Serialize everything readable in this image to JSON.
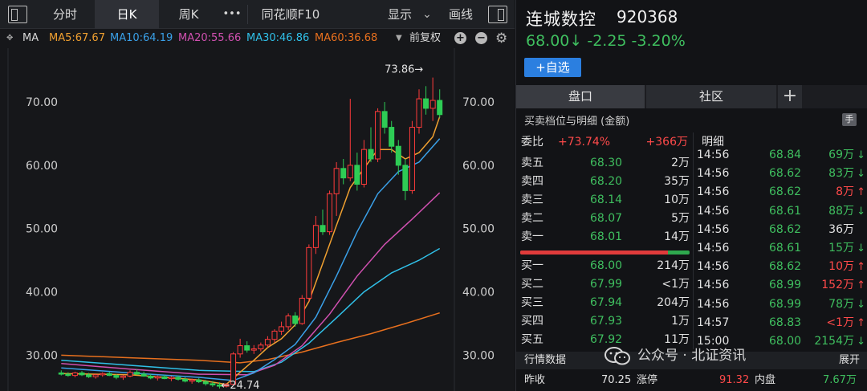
{
  "toolbar": {
    "tabs": [
      "分时",
      "日K",
      "周K"
    ],
    "more": "•••",
    "f10": "同花顺F10",
    "display": "显示",
    "draw": "画线"
  },
  "ma_bar": {
    "label": "MA",
    "ma5": "MA5:67.67",
    "ma10": "MA10:64.19",
    "ma20": "MA20:55.66",
    "ma30": "MA30:46.86",
    "ma60": "MA60:36.68",
    "adjust": "前复权",
    "plus": "+",
    "minus": "−",
    "colors": {
      "ma5": "#f0a030",
      "ma10": "#3aa0e8",
      "ma20": "#d050b0",
      "ma30": "#30c0e8",
      "ma40": "#e08030"
    }
  },
  "chart_data": {
    "type": "candlestick",
    "y_ticks": [
      "70.00",
      "60.00",
      "50.00",
      "40.00",
      "30.00"
    ],
    "ylim": [
      26.5,
      78.5
    ],
    "high_label": "73.86→",
    "low_label": "←24.74",
    "colors": {
      "up": "#ff3b3b",
      "down": "#2ecc55",
      "ma5": "#f0a030",
      "ma10": "#3aa0e8",
      "ma20": "#d050b0",
      "ma30": "#30c0e8",
      "ma60": "#e8701e"
    },
    "candles": [
      [
        27.2,
        27.6,
        26.8,
        27.0
      ],
      [
        27.0,
        27.3,
        26.6,
        26.8
      ],
      [
        26.8,
        27.4,
        26.5,
        27.2
      ],
      [
        27.2,
        27.5,
        26.7,
        26.9
      ],
      [
        26.9,
        27.2,
        26.4,
        26.6
      ],
      [
        26.6,
        27.0,
        26.3,
        26.9
      ],
      [
        26.9,
        27.3,
        26.6,
        27.1
      ],
      [
        27.1,
        27.4,
        26.7,
        26.8
      ],
      [
        26.8,
        27.0,
        26.2,
        26.5
      ],
      [
        26.5,
        26.9,
        26.1,
        26.7
      ],
      [
        26.7,
        27.6,
        26.5,
        27.3
      ],
      [
        27.3,
        27.8,
        26.9,
        27.0
      ],
      [
        27.0,
        27.4,
        26.6,
        26.7
      ],
      [
        26.7,
        27.0,
        26.2,
        26.4
      ],
      [
        26.4,
        26.8,
        26.0,
        26.6
      ],
      [
        26.6,
        26.9,
        26.2,
        26.3
      ],
      [
        26.3,
        26.7,
        25.9,
        26.5
      ],
      [
        26.5,
        26.8,
        26.0,
        26.2
      ],
      [
        26.2,
        26.5,
        25.7,
        25.9
      ],
      [
        25.9,
        26.3,
        25.5,
        26.1
      ],
      [
        26.1,
        26.4,
        25.6,
        25.8
      ],
      [
        25.8,
        26.1,
        25.2,
        25.5
      ],
      [
        25.5,
        25.9,
        25.0,
        25.3
      ],
      [
        25.3,
        25.7,
        24.74,
        25.1
      ],
      [
        25.1,
        25.6,
        24.9,
        25.4
      ],
      [
        25.4,
        30.5,
        25.3,
        30.2
      ],
      [
        30.2,
        32.6,
        29.6,
        31.5
      ],
      [
        31.5,
        32.2,
        30.4,
        30.8
      ],
      [
        30.8,
        31.6,
        30.2,
        31.0
      ],
      [
        31.0,
        32.0,
        30.6,
        31.6
      ],
      [
        31.6,
        33.0,
        31.2,
        32.5
      ],
      [
        32.5,
        34.1,
        32.0,
        33.8
      ],
      [
        33.8,
        35.3,
        33.2,
        34.5
      ],
      [
        34.5,
        36.6,
        34.0,
        36.2
      ],
      [
        36.2,
        36.8,
        34.5,
        35.0
      ],
      [
        35.0,
        39.5,
        34.8,
        39.0
      ],
      [
        39.0,
        47.5,
        38.5,
        47.0
      ],
      [
        47.0,
        52.0,
        46.0,
        50.5
      ],
      [
        50.5,
        53.0,
        49.0,
        49.5
      ],
      [
        49.5,
        56.0,
        49.0,
        55.5
      ],
      [
        55.5,
        60.5,
        52.0,
        59.5
      ],
      [
        59.5,
        61.0,
        57.0,
        58.0
      ],
      [
        58.0,
        70.5,
        57.5,
        60.0
      ],
      [
        60.0,
        62.0,
        56.0,
        57.0
      ],
      [
        57.0,
        64.0,
        56.5,
        62.5
      ],
      [
        62.5,
        66.0,
        60.5,
        61.0
      ],
      [
        61.0,
        69.0,
        60.5,
        68.5
      ],
      [
        68.5,
        70.0,
        65.0,
        66.0
      ],
      [
        66.0,
        67.0,
        62.0,
        63.0
      ],
      [
        63.0,
        64.0,
        58.5,
        60.0
      ],
      [
        60.0,
        61.0,
        54.5,
        56.0
      ],
      [
        56.0,
        67.0,
        55.5,
        66.0
      ],
      [
        66.0,
        72.0,
        65.0,
        70.5
      ],
      [
        70.5,
        72.5,
        68.0,
        69.0
      ],
      [
        69.0,
        73.86,
        67.0,
        70.25
      ],
      [
        70.25,
        72.0,
        67.5,
        68.0
      ]
    ],
    "ma5_line": [
      [
        0,
        27.1
      ],
      [
        10,
        26.9
      ],
      [
        20,
        26.1
      ],
      [
        24,
        25.4
      ],
      [
        26,
        27.3
      ],
      [
        28,
        29.2
      ],
      [
        30,
        31.2
      ],
      [
        32,
        32.6
      ],
      [
        34,
        34.8
      ],
      [
        36,
        38.5
      ],
      [
        38,
        44.5
      ],
      [
        40,
        50.5
      ],
      [
        42,
        56.5
      ],
      [
        44,
        59.5
      ],
      [
        46,
        62.5
      ],
      [
        48,
        62.5
      ],
      [
        50,
        61.0
      ],
      [
        52,
        62.0
      ],
      [
        54,
        64.5
      ],
      [
        55,
        67.67
      ]
    ],
    "ma10_line": [
      [
        0,
        28.0
      ],
      [
        10,
        27.2
      ],
      [
        20,
        26.5
      ],
      [
        25,
        26.0
      ],
      [
        28,
        27.2
      ],
      [
        31,
        29.3
      ],
      [
        34,
        31.7
      ],
      [
        37,
        36.0
      ],
      [
        40,
        42.5
      ],
      [
        43,
        49.5
      ],
      [
        46,
        55.5
      ],
      [
        49,
        59.0
      ],
      [
        52,
        60.5
      ],
      [
        55,
        64.19
      ]
    ],
    "ma20_line": [
      [
        0,
        28.7
      ],
      [
        10,
        27.8
      ],
      [
        20,
        27.0
      ],
      [
        27,
        26.9
      ],
      [
        31,
        28.4
      ],
      [
        35,
        31.5
      ],
      [
        39,
        36.5
      ],
      [
        43,
        42.5
      ],
      [
        47,
        47.5
      ],
      [
        51,
        51.5
      ],
      [
        55,
        55.66
      ]
    ],
    "ma30_line": [
      [
        0,
        29.2
      ],
      [
        10,
        28.4
      ],
      [
        20,
        27.6
      ],
      [
        28,
        27.4
      ],
      [
        32,
        28.9
      ],
      [
        36,
        31.9
      ],
      [
        40,
        35.9
      ],
      [
        44,
        40.0
      ],
      [
        48,
        43.0
      ],
      [
        52,
        45.0
      ],
      [
        55,
        46.86
      ]
    ],
    "ma60_line": [
      [
        0,
        30.0
      ],
      [
        10,
        29.6
      ],
      [
        20,
        29.2
      ],
      [
        26,
        28.8
      ],
      [
        30,
        29.3
      ],
      [
        35,
        30.5
      ],
      [
        40,
        32.0
      ],
      [
        45,
        33.4
      ],
      [
        50,
        35.0
      ],
      [
        55,
        36.68
      ]
    ]
  },
  "stock": {
    "name": "连城数控",
    "code": "920368",
    "price_line": "68.00↓ -2.25 -3.20%",
    "fav_button": "+自选"
  },
  "quote_tabs": [
    "盘口",
    "社区"
  ],
  "tab_plus": "+",
  "orderbook": {
    "header": "买卖档位与明细 (金额)",
    "hand_icon": "手",
    "ratio_label": "委比",
    "ratio_pct": "+73.74%",
    "ratio_amt": "+366万",
    "asks": [
      {
        "label": "卖五",
        "price": "68.30",
        "vol": "2万"
      },
      {
        "label": "卖四",
        "price": "68.20",
        "vol": "35万"
      },
      {
        "label": "卖三",
        "price": "68.14",
        "vol": "10万"
      },
      {
        "label": "卖二",
        "price": "68.07",
        "vol": "5万"
      },
      {
        "label": "卖一",
        "price": "68.01",
        "vol": "14万"
      }
    ],
    "bids": [
      {
        "label": "买一",
        "price": "68.00",
        "vol": "214万"
      },
      {
        "label": "买二",
        "price": "67.99",
        "vol": "<1万"
      },
      {
        "label": "买三",
        "price": "67.94",
        "vol": "204万"
      },
      {
        "label": "买四",
        "price": "67.93",
        "vol": "1万"
      },
      {
        "label": "买五",
        "price": "67.92",
        "vol": "11万"
      }
    ],
    "bid_ratio": 0.87
  },
  "trades": {
    "title": "明细",
    "rows": [
      {
        "time": "14:56",
        "price": "68.84",
        "vol": "69万",
        "dir": "down"
      },
      {
        "time": "14:56",
        "price": "68.62",
        "vol": "83万",
        "dir": "down"
      },
      {
        "time": "14:56",
        "price": "68.62",
        "vol": "8万",
        "dir": "up"
      },
      {
        "time": "14:56",
        "price": "68.61",
        "vol": "88万",
        "dir": "down"
      },
      {
        "time": "14:56",
        "price": "68.62",
        "vol": "36万",
        "dir": "none"
      },
      {
        "time": "14:56",
        "price": "68.61",
        "vol": "15万",
        "dir": "down"
      },
      {
        "time": "14:56",
        "price": "68.62",
        "vol": "10万",
        "dir": "up"
      },
      {
        "time": "14:56",
        "price": "68.99",
        "vol": "152万",
        "dir": "up"
      },
      {
        "time": "14:56",
        "price": "68.99",
        "vol": "78万",
        "dir": "down"
      },
      {
        "time": "14:57",
        "price": "68.83",
        "vol": "<1万",
        "dir": "up"
      },
      {
        "time": "15:00",
        "price": "68.00",
        "vol": "2154万",
        "dir": "down"
      }
    ]
  },
  "bottom": {
    "market_data": "行情数据",
    "expand": "展开",
    "prev_close_label": "昨收",
    "prev_close": "70.25",
    "limit_up_label": "涨停",
    "limit_up": "91.32",
    "inner_label": "内盘",
    "inner": "7.67万"
  },
  "watermark": "公众号 · 北证资讯"
}
